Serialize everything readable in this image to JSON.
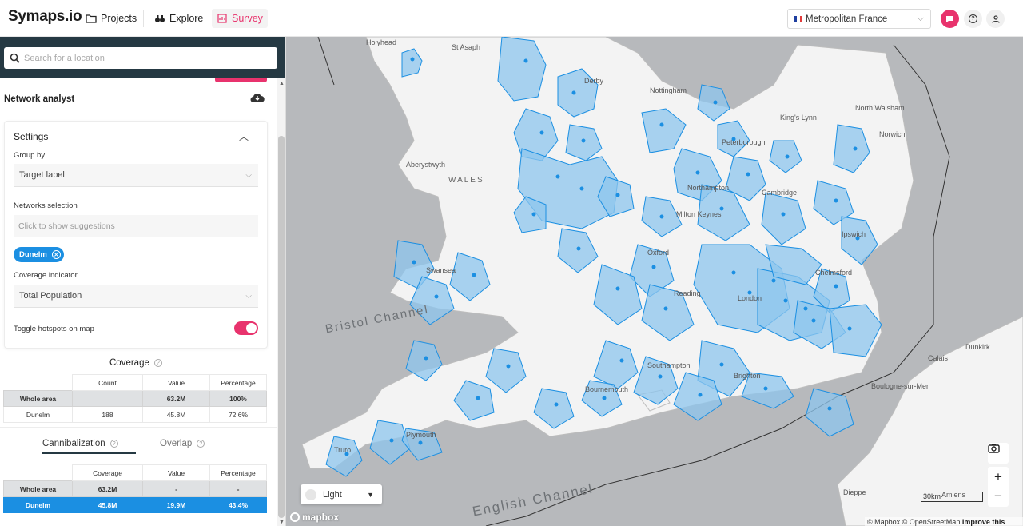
{
  "app": {
    "logo": "Symaps.io",
    "nav": [
      {
        "label": "Projects",
        "icon": "folder-icon"
      },
      {
        "label": "Explore",
        "icon": "binoculars-icon"
      },
      {
        "label": "Survey",
        "icon": "survey-icon"
      }
    ],
    "country": "Metropolitan France",
    "accent": "#e8336d"
  },
  "sidebar": {
    "search_placeholder": "Search for a location",
    "section_title": "Network analyst",
    "settings": {
      "title": "Settings",
      "group_by_label": "Group by",
      "group_by_value": "Target label",
      "networks_label": "Networks selection",
      "networks_placeholder": "Click to show suggestions",
      "chip": "Dunelm",
      "coverage_indicator_label": "Coverage indicator",
      "coverage_indicator_value": "Total Population",
      "toggle_label": "Toggle hotspots on map",
      "toggle_on": true
    },
    "coverage": {
      "title": "Coverage",
      "headers": [
        "",
        "Count",
        "Value",
        "Percentage"
      ],
      "rows": [
        [
          "Whole area",
          "",
          "63.2M",
          "100%"
        ],
        [
          "Dunelm",
          "188",
          "45.8M",
          "72.6%"
        ]
      ]
    },
    "tabs": [
      "Cannibalization",
      "Overlap"
    ],
    "cannibalization": {
      "headers": [
        "",
        "Coverage",
        "Value",
        "Percentage"
      ],
      "rows": [
        [
          "Whole area",
          "63.2M",
          "-",
          "-"
        ],
        [
          "Dunelm",
          "45.8M",
          "19.9M",
          "43.4%"
        ]
      ]
    }
  },
  "map": {
    "style": "Light",
    "sea_labels": [
      "Bristol Channel",
      "English Channel"
    ],
    "region_label": "WALES",
    "places": [
      "Holyhead",
      "St Asaph",
      "Derby",
      "Nottingham",
      "King's Lynn",
      "North Walsham",
      "Norwich",
      "Peterborough",
      "Aberystwyth",
      "Cambridge",
      "Northampton",
      "Ipswich",
      "Milton Keynes",
      "Swansea",
      "Oxford",
      "Chelmsford",
      "Reading",
      "London",
      "Southampton",
      "Bournemouth",
      "Brighton",
      "Plymouth",
      "Truro",
      "Calais",
      "Dunkirk",
      "Boulogne-sur-Mer",
      "Dieppe",
      "Amiens"
    ],
    "scale": "30km",
    "attribution": "© Mapbox © OpenStreetMap",
    "improve": "Improve this map",
    "mapbox": "mapbox",
    "sea_color": "#b7b9bc",
    "land_color": "#f3f3f3",
    "coverage_color": "#1b8fe2"
  }
}
